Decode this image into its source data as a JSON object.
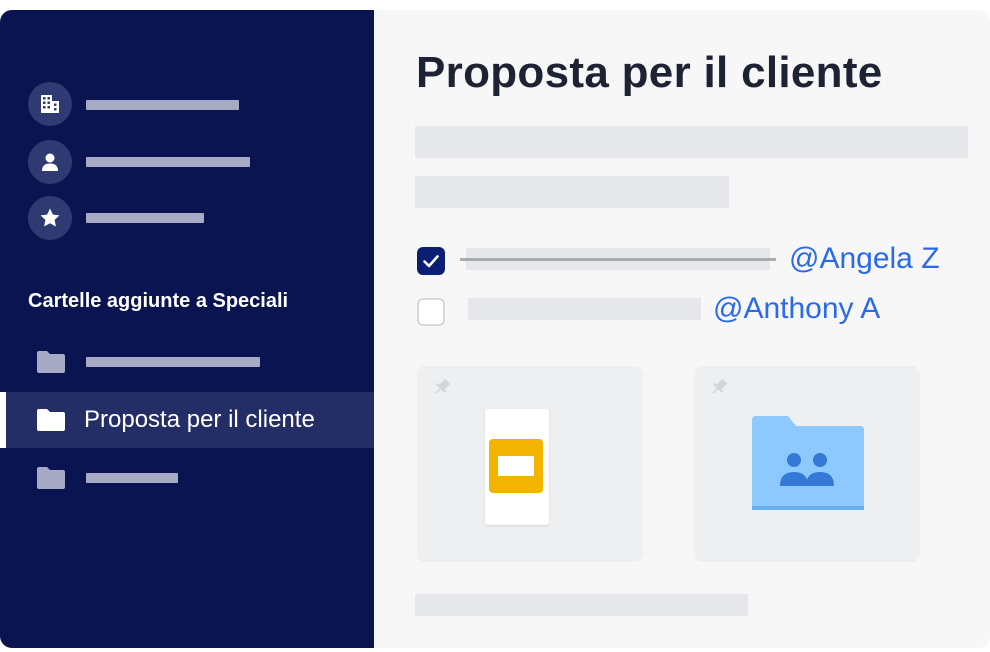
{
  "sidebar": {
    "nav_icons": [
      "building-icon",
      "person-icon",
      "star-icon"
    ],
    "section_title": "Cartelle aggiunte a Speciali",
    "active_folder": "Proposta per il cliente"
  },
  "main": {
    "title": "Proposta per il cliente",
    "tasks": [
      {
        "checked": true,
        "mention": "@Angela Z"
      },
      {
        "checked": false,
        "mention": "@Anthony A"
      }
    ],
    "cards": [
      {
        "icon": "presentation-file-icon"
      },
      {
        "icon": "shared-folder-icon"
      }
    ]
  },
  "colors": {
    "sidebar_bg": "#0a1450",
    "accent_blue": "#2a6ae8",
    "checkbox_checked": "#0a1f72",
    "slides_yellow": "#f2b400",
    "folder_blue": "#8dc8ff"
  }
}
